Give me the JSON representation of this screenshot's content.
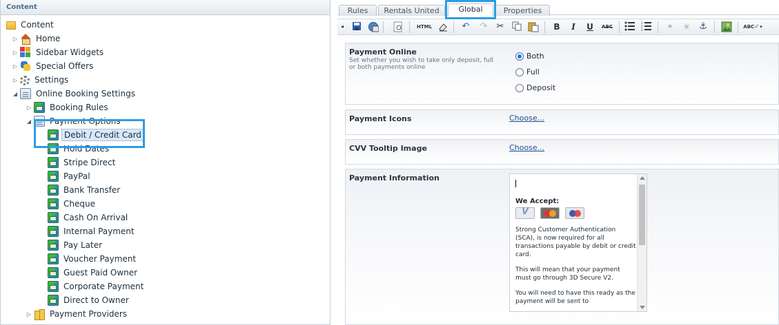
{
  "left_panel": {
    "header": "Content",
    "tree": [
      {
        "label": "Content",
        "icon": "folder-icon",
        "level": 0,
        "expand": ""
      },
      {
        "label": "Home",
        "icon": "home-icon",
        "level": 1,
        "expand": "closed"
      },
      {
        "label": "Sidebar Widgets",
        "icon": "widgets-icon",
        "level": 1,
        "expand": "closed"
      },
      {
        "label": "Special Offers",
        "icon": "offers-icon",
        "level": 1,
        "expand": "closed"
      },
      {
        "label": "Settings",
        "icon": "gear-icon",
        "level": 1,
        "expand": "closed"
      },
      {
        "label": "Online Booking Settings",
        "icon": "form-icon",
        "level": 1,
        "expand": "open"
      },
      {
        "label": "Booking Rules",
        "icon": "card-icon",
        "level": 2,
        "expand": "closed"
      },
      {
        "label": "Payment Options",
        "icon": "form-icon",
        "level": 2,
        "expand": "open"
      },
      {
        "label": "Debit / Credit Card",
        "icon": "card-icon",
        "level": 3,
        "expand": "",
        "selected": true
      },
      {
        "label": "Hold Dates",
        "icon": "card-icon",
        "level": 3,
        "expand": ""
      },
      {
        "label": "Stripe Direct",
        "icon": "card-icon",
        "level": 3,
        "expand": ""
      },
      {
        "label": "PayPal",
        "icon": "card-icon",
        "level": 3,
        "expand": ""
      },
      {
        "label": "Bank Transfer",
        "icon": "card-icon",
        "level": 3,
        "expand": ""
      },
      {
        "label": "Cheque",
        "icon": "card-icon",
        "level": 3,
        "expand": ""
      },
      {
        "label": "Cash On Arrival",
        "icon": "card-icon",
        "level": 3,
        "expand": ""
      },
      {
        "label": "Internal Payment",
        "icon": "card-icon",
        "level": 3,
        "expand": ""
      },
      {
        "label": "Pay Later",
        "icon": "card-icon",
        "level": 3,
        "expand": ""
      },
      {
        "label": "Voucher Payment",
        "icon": "card-icon",
        "level": 3,
        "expand": ""
      },
      {
        "label": "Guest Paid Owner",
        "icon": "card-icon",
        "level": 3,
        "expand": ""
      },
      {
        "label": "Corporate Payment",
        "icon": "card-icon",
        "level": 3,
        "expand": ""
      },
      {
        "label": "Direct to Owner",
        "icon": "card-icon",
        "level": 3,
        "expand": ""
      },
      {
        "label": "Payment Providers",
        "icon": "provider-icon",
        "level": 2,
        "expand": "closed"
      }
    ]
  },
  "tabs": [
    {
      "label": "Rules",
      "active": false
    },
    {
      "label": "Rentals United",
      "active": false
    },
    {
      "label": "Global",
      "active": true
    },
    {
      "label": "Properties",
      "active": false
    }
  ],
  "toolbar": {
    "icons": [
      "collapse-icon",
      "save-icon",
      "spellcheck-globe-icon",
      "preview-icon",
      "html-icon",
      "eraser-icon",
      "undo-icon",
      "redo-icon",
      "cut-icon",
      "copy-icon",
      "paste-icon",
      "bold-icon",
      "italic-icon",
      "underline-icon",
      "strikethrough-icon",
      "bulleted-list-icon",
      "numbered-list-icon",
      "link-icon",
      "unlink-icon",
      "anchor-icon",
      "image-icon",
      "spellcheck-icon"
    ],
    "html_label": "HTML",
    "bold_label": "B",
    "italic_label": "I",
    "underline_label": "U",
    "strike_label": "ABC",
    "spell_label": "ABC"
  },
  "form": {
    "payment_online": {
      "label": "Payment Online",
      "description": "Set whether you wish to take only deposit, full or both payments online",
      "options": [
        {
          "label": "Both",
          "selected": true
        },
        {
          "label": "Full",
          "selected": false
        },
        {
          "label": "Deposit",
          "selected": false
        }
      ]
    },
    "payment_icons": {
      "label": "Payment Icons",
      "link": "Choose..."
    },
    "cvv_tooltip": {
      "label": "CVV Tooltip Image",
      "link": "Choose..."
    },
    "payment_information": {
      "label": "Payment Information",
      "content": {
        "heading": "We Accept:",
        "cards": [
          "visa-card-icon",
          "mastercard-icon",
          "maestro-icon"
        ],
        "paragraphs": [
          "Strong Customer Authentication  (SCA), is now required for all transactions payable by debit or credit card.",
          "This will mean that your payment must go through 3D Secure V2.",
          "You will need to have this ready as the payment will be sent to"
        ]
      }
    }
  },
  "colors": {
    "highlight": "#2e9be5",
    "link": "#1a4f8a",
    "header_text": "#4b6e8e"
  }
}
